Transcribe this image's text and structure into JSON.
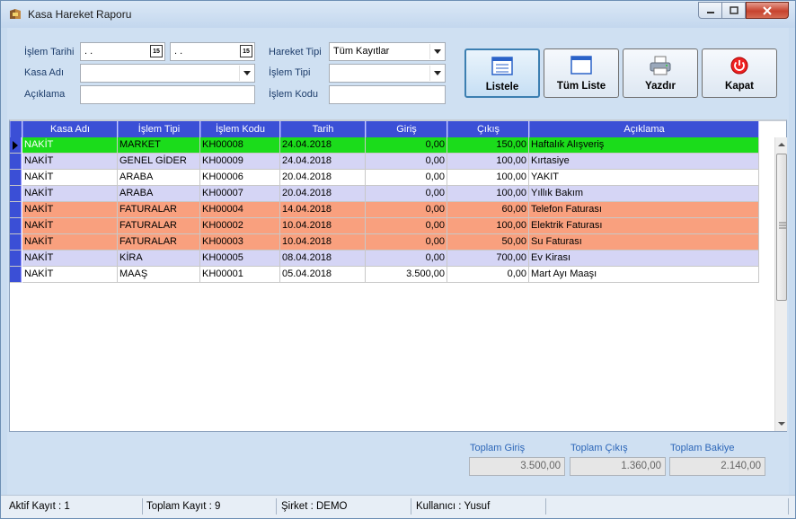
{
  "window": {
    "title": "Kasa Hareket Raporu"
  },
  "filters": {
    "islem_tarihi_label": "İşlem Tarihi",
    "date_start": " .  .",
    "date_end": " .  .",
    "kasa_adi_label": "Kasa Adı",
    "kasa_adi_value": "",
    "aciklama_label": "Açıklama",
    "aciklama_value": "",
    "hareket_tipi_label": "Hareket Tipi",
    "hareket_tipi_value": "Tüm Kayıtlar",
    "islem_tipi_label": "İşlem Tipi",
    "islem_tipi_value": "",
    "islem_kodu_label": "İşlem Kodu",
    "islem_kodu_value": "",
    "calendar_glyph": "15"
  },
  "toolbar": {
    "listele": "Listele",
    "tum_liste": "Tüm Liste",
    "yazdir": "Yazdır",
    "kapat": "Kapat"
  },
  "grid": {
    "columns": [
      "Kasa Adı",
      "İşlem Tipi",
      "İşlem Kodu",
      "Tarih",
      "Giriş",
      "Çıkış",
      "Açıklama"
    ],
    "rows": [
      {
        "kasa": "NAKİT",
        "tip": "MARKET",
        "kod": "KH00008",
        "tarih": "24.04.2018",
        "giris": "0,00",
        "cikis": "150,00",
        "aciklama": "Haftalık Alışveriş",
        "color": "#1bdc1b",
        "current": true
      },
      {
        "kasa": "NAKİT",
        "tip": "GENEL GİDER",
        "kod": "KH00009",
        "tarih": "24.04.2018",
        "giris": "0,00",
        "cikis": "100,00",
        "aciklama": "Kırtasiye",
        "color": "#d5d5f5",
        "current": false
      },
      {
        "kasa": "NAKİT",
        "tip": "ARABA",
        "kod": "KH00006",
        "tarih": "20.04.2018",
        "giris": "0,00",
        "cikis": "100,00",
        "aciklama": "YAKIT",
        "color": "#ffffff",
        "current": false
      },
      {
        "kasa": "NAKİT",
        "tip": "ARABA",
        "kod": "KH00007",
        "tarih": "20.04.2018",
        "giris": "0,00",
        "cikis": "100,00",
        "aciklama": "Yıllık Bakım",
        "color": "#d5d5f5",
        "current": false
      },
      {
        "kasa": "NAKİT",
        "tip": "FATURALAR",
        "kod": "KH00004",
        "tarih": "14.04.2018",
        "giris": "0,00",
        "cikis": "60,00",
        "aciklama": "Telefon Faturası",
        "color": "#f9a07e",
        "current": false
      },
      {
        "kasa": "NAKİT",
        "tip": "FATURALAR",
        "kod": "KH00002",
        "tarih": "10.04.2018",
        "giris": "0,00",
        "cikis": "100,00",
        "aciklama": "Elektrik Faturası",
        "color": "#f9a07e",
        "current": false
      },
      {
        "kasa": "NAKİT",
        "tip": "FATURALAR",
        "kod": "KH00003",
        "tarih": "10.04.2018",
        "giris": "0,00",
        "cikis": "50,00",
        "aciklama": "Su Faturası",
        "color": "#f9a07e",
        "current": false
      },
      {
        "kasa": "NAKİT",
        "tip": "KİRA",
        "kod": "KH00005",
        "tarih": "08.04.2018",
        "giris": "0,00",
        "cikis": "700,00",
        "aciklama": "Ev Kirası",
        "color": "#d5d5f5",
        "current": false
      },
      {
        "kasa": "NAKİT",
        "tip": "MAAŞ",
        "kod": "KH00001",
        "tarih": "05.04.2018",
        "giris": "3.500,00",
        "cikis": "0,00",
        "aciklama": "Mart Ayı Maaşı",
        "color": "#ffffff",
        "current": false
      }
    ]
  },
  "totals": {
    "giris_label": "Toplam Giriş",
    "giris_value": "3.500,00",
    "cikis_label": "Toplam Çıkış",
    "cikis_value": "1.360,00",
    "bakiye_label": "Toplam Bakiye",
    "bakiye_value": "2.140,00"
  },
  "status": {
    "aktif": "Aktif Kayıt : 1",
    "toplam": "Toplam Kayıt : 9",
    "sirket": "Şirket : DEMO",
    "kullanici": "Kullanıcı : Yusuf",
    "extra": ""
  }
}
